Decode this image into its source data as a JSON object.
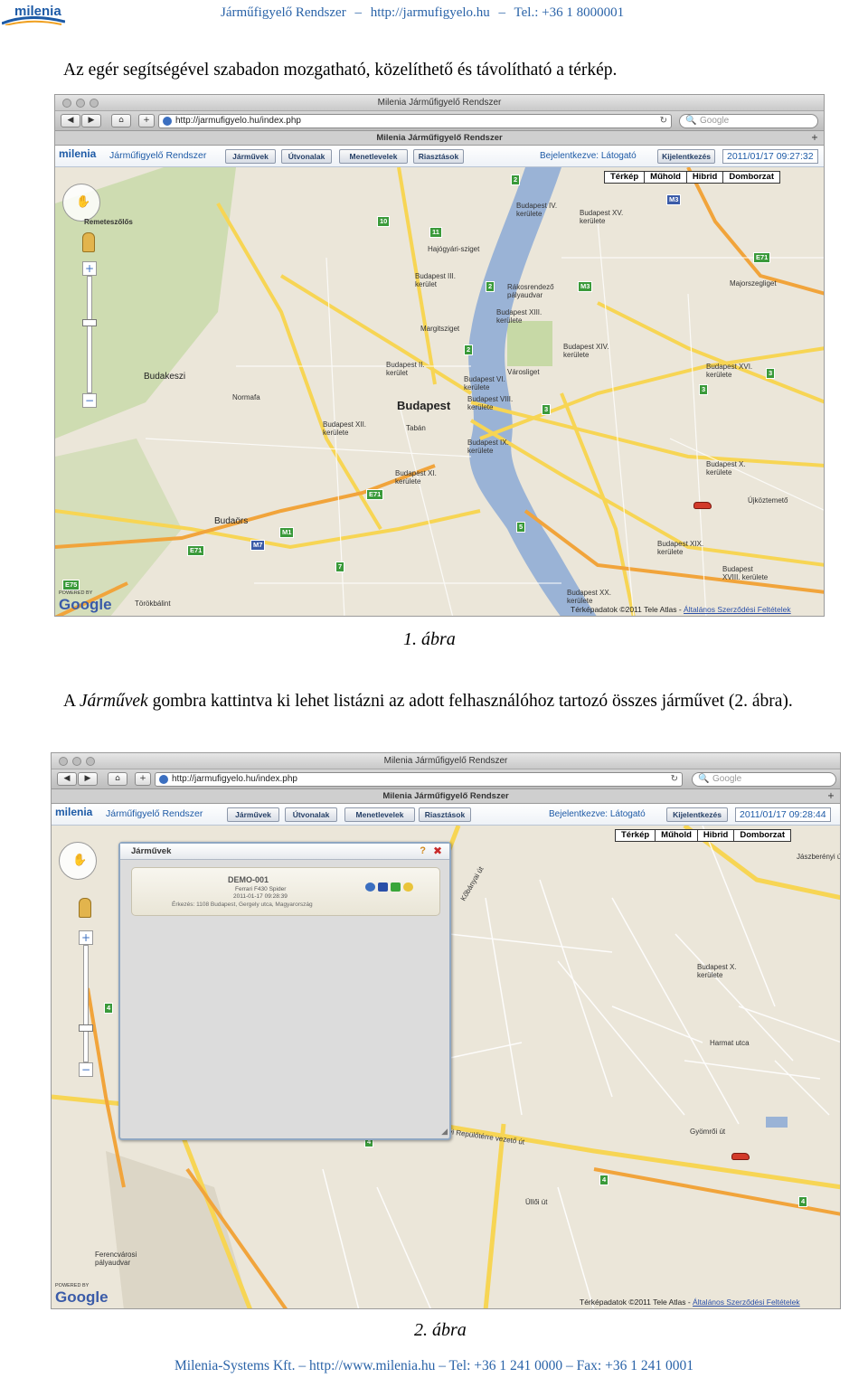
{
  "header": {
    "logo": "milenia",
    "system_name": "Járműfigyelő Rendszer",
    "url": "http://jarmufigyelo.hu",
    "phone": "Tel.: +36 1 8000001"
  },
  "paragraph1": "Az egér segítségével szabadon mozgatható, közelíthető és távolítható a térkép.",
  "caption1": "1. ábra",
  "paragraph2": {
    "before": "A ",
    "emphasis": "Járművek",
    "after": " gombra kattintva ki lehet listázni az adott felhasználóhoz tartozó összes járművet (2. ábra)."
  },
  "caption2": "2. ábra",
  "footer": "Milenia-Systems Kft. – http://www.milenia.hu – Tel: +36 1 241 0000 – Fax: +36 1 241 0001",
  "browser": {
    "window_title": "Milenia Járműfigyelő Rendszer",
    "url": "http://jarmufigyelo.hu/index.php",
    "search_placeholder": "Google",
    "tab_title": "Milenia Járműfigyelő Rendszer",
    "reload_icon": "↻",
    "search_icon": "🔍",
    "new_tab": "+"
  },
  "app": {
    "logo": "milenia",
    "title": "Járműfigyelő Rendszer",
    "menu": [
      "Járművek",
      "Útvonalak",
      "Menetlevelek",
      "Riasztások"
    ],
    "login": "Bejelentkezve: Látogató",
    "logout": "Kijelentkezés",
    "time1": "2011/01/17 09:27:32",
    "time2": "2011/01/17 09:28:44"
  },
  "map": {
    "types": [
      "Térkép",
      "Műhold",
      "Hibrid",
      "Domborzat"
    ],
    "zoom_in": "+",
    "zoom_out": "−",
    "pan_icon": "✋",
    "powered_by": "POWERED BY",
    "google": "Google",
    "copyright": "Térképadatok ©2011 Tele Atlas - ",
    "terms": "Általános Szerződési Feltételek",
    "labels1": {
      "remeteszolos": "Remeteszőlős",
      "budakeszi": "Budakeszi",
      "budapest": "Budapest",
      "kerulet4": "Budapest IV. kerülete",
      "kerulet15": "Budapest XV. kerülete",
      "kerulet3": "Budapest III. kerület",
      "kerulet13": "Budapest XIII. kerülete",
      "kerulet2": "Budapest II. kerület",
      "kerulet6": "Budapest VI. kerülete",
      "kerulet8": "Budapest VIII. kerülete",
      "kerulet14": "Budapest XIV. kerülete",
      "kerulet16": "Budapest XVI. kerülete",
      "kerulet12": "Budapest XII. kerülete",
      "kerulet9": "Budapest IX. kerülete",
      "kerulet11": "Budapest XI. kerülete",
      "kerulet10": "Budapest X. kerülete",
      "kerulet19": "Budapest XIX. kerülete",
      "kerulet18": "Budapest XVIII. kerülete",
      "kerulet20": "Budapest XX. kerülete",
      "varosliget": "Városliget",
      "margitsziget": "Margitsziget",
      "hajogyari": "Hajógyári-sziget",
      "rakosrendezo": "Rákosrendező pályaudvar",
      "majorsze": "Majorszegliget",
      "ujkoztemeto": "Újköztemető",
      "budaors": "Budaörs",
      "torokbalint": "Törökbálint",
      "normafa": "Normafa",
      "taban": "Tabán"
    },
    "labels2": {
      "kerulet10": "Budapest X. kerülete",
      "ferencvarosi": "Ferencvárosi pályaudvar",
      "ferihegyi": "Ferihegyi Repülőtérre vezető út",
      "ulloi": "Üllői út",
      "jaszbereny": "Jászberényi út",
      "gyomroi": "Gyömrői út",
      "harmat": "Harmat utca",
      "kozma": "Kőbányai út"
    }
  },
  "vehicles_panel": {
    "title": "Járművek",
    "help": "?",
    "close": "✖",
    "resize": "◢",
    "vehicle": {
      "name": "DEMO-001",
      "model": "Ferrari F430 Spider",
      "time": "2011-01-17 09:28:39",
      "address": "Érkezés: 1108 Budapest, Gergely utca, Magyarország"
    }
  },
  "colors": {
    "header_blue": "#2a63a8",
    "app_blue": "#1d5aa6",
    "road_yellow": "#f7d554",
    "road_orange": "#f1a43b",
    "river": "#9ab3d6",
    "park": "#c7d9a6",
    "car_red": "#d23a2a"
  }
}
